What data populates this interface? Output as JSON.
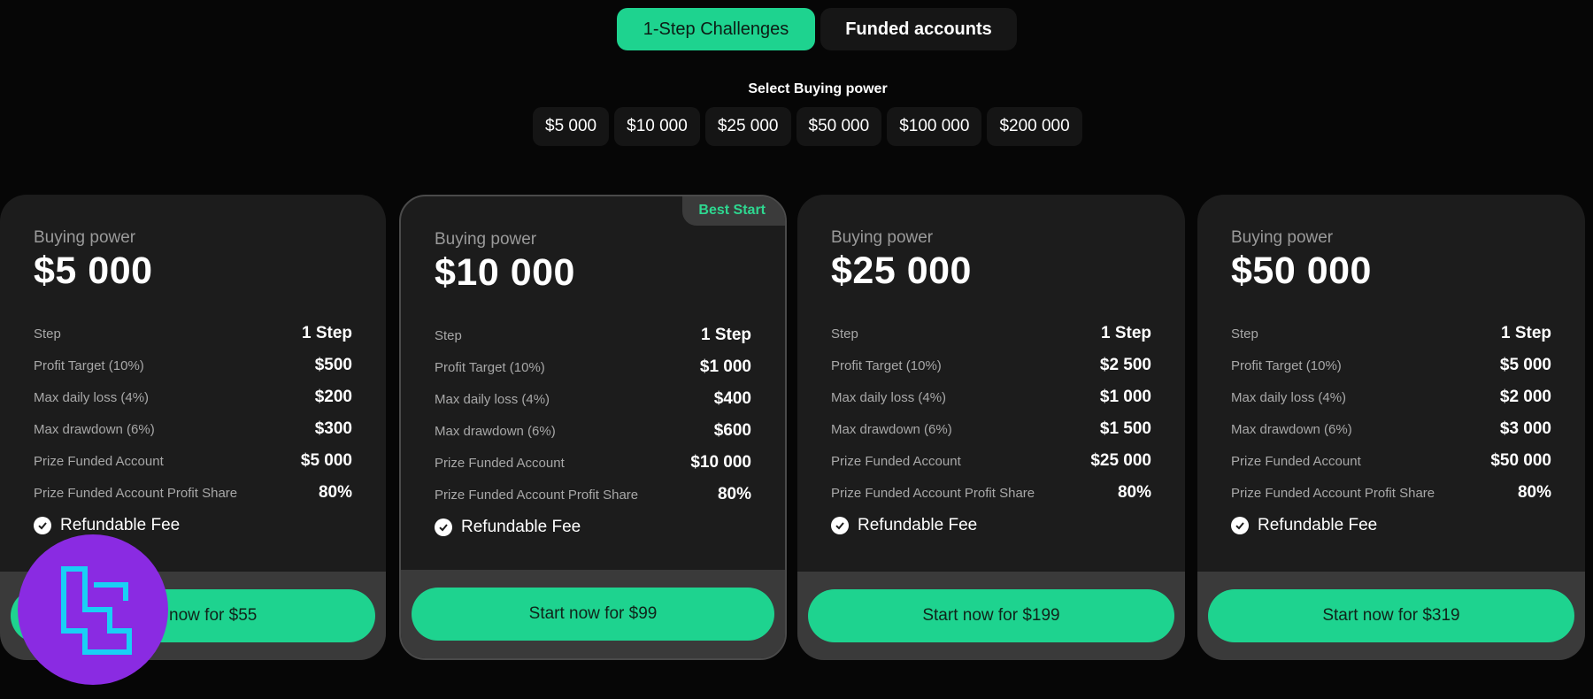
{
  "tabs": [
    {
      "label": "1-Step Challenges",
      "active": true
    },
    {
      "label": "Funded accounts",
      "active": false
    }
  ],
  "buying_power": {
    "title": "Select Buying power",
    "options": [
      "$5 000",
      "$10 000",
      "$25 000",
      "$50 000",
      "$100 000",
      "$200 000"
    ]
  },
  "cards": [
    {
      "label": "Buying power",
      "value": "$5 000",
      "rows": [
        {
          "label": "Step",
          "value": "1 Step"
        },
        {
          "label": "Profit Target (10%)",
          "value": "$500"
        },
        {
          "label": "Max daily loss (4%)",
          "value": "$200"
        },
        {
          "label": "Max drawdown (6%)",
          "value": "$300"
        },
        {
          "label": "Prize Funded Account",
          "value": "$5 000"
        },
        {
          "label": "Prize Funded Account Profit Share",
          "value": "80%"
        }
      ],
      "fee": "Refundable Fee",
      "cta": "Start now for $55"
    },
    {
      "label": "Buying power",
      "value": "$10 000",
      "badge": "Best Start",
      "rows": [
        {
          "label": "Step",
          "value": "1 Step"
        },
        {
          "label": "Profit Target (10%)",
          "value": "$1 000"
        },
        {
          "label": "Max daily loss (4%)",
          "value": "$400"
        },
        {
          "label": "Max drawdown (6%)",
          "value": "$600"
        },
        {
          "label": "Prize Funded Account",
          "value": "$10 000"
        },
        {
          "label": "Prize Funded Account Profit Share",
          "value": "80%"
        }
      ],
      "fee": "Refundable Fee",
      "cta": "Start now for $99"
    },
    {
      "label": "Buying power",
      "value": "$25 000",
      "rows": [
        {
          "label": "Step",
          "value": "1 Step"
        },
        {
          "label": "Profit Target (10%)",
          "value": "$2 500"
        },
        {
          "label": "Max daily loss (4%)",
          "value": "$1 000"
        },
        {
          "label": "Max drawdown (6%)",
          "value": "$1 500"
        },
        {
          "label": "Prize Funded Account",
          "value": "$25 000"
        },
        {
          "label": "Prize Funded Account Profit Share",
          "value": "80%"
        }
      ],
      "fee": "Refundable Fee",
      "cta": "Start now for $199"
    },
    {
      "label": "Buying power",
      "value": "$50 000",
      "rows": [
        {
          "label": "Step",
          "value": "1 Step"
        },
        {
          "label": "Profit Target (10%)",
          "value": "$5 000"
        },
        {
          "label": "Max daily loss (4%)",
          "value": "$2 000"
        },
        {
          "label": "Max drawdown (6%)",
          "value": "$3 000"
        },
        {
          "label": "Prize Funded Account",
          "value": "$50 000"
        },
        {
          "label": "Prize Funded Account Profit Share",
          "value": "80%"
        }
      ],
      "fee": "Refundable Fee",
      "cta": "Start now for $319"
    }
  ],
  "colors": {
    "accent": "#1ed38f",
    "card_bg": "#1c1c1c",
    "page_bg": "#060606",
    "logo_bg": "#8a2be2",
    "logo_stroke": "#19d0f5"
  },
  "icons": {
    "check": "check-circle-icon",
    "logo": "brand-logo-icon"
  }
}
